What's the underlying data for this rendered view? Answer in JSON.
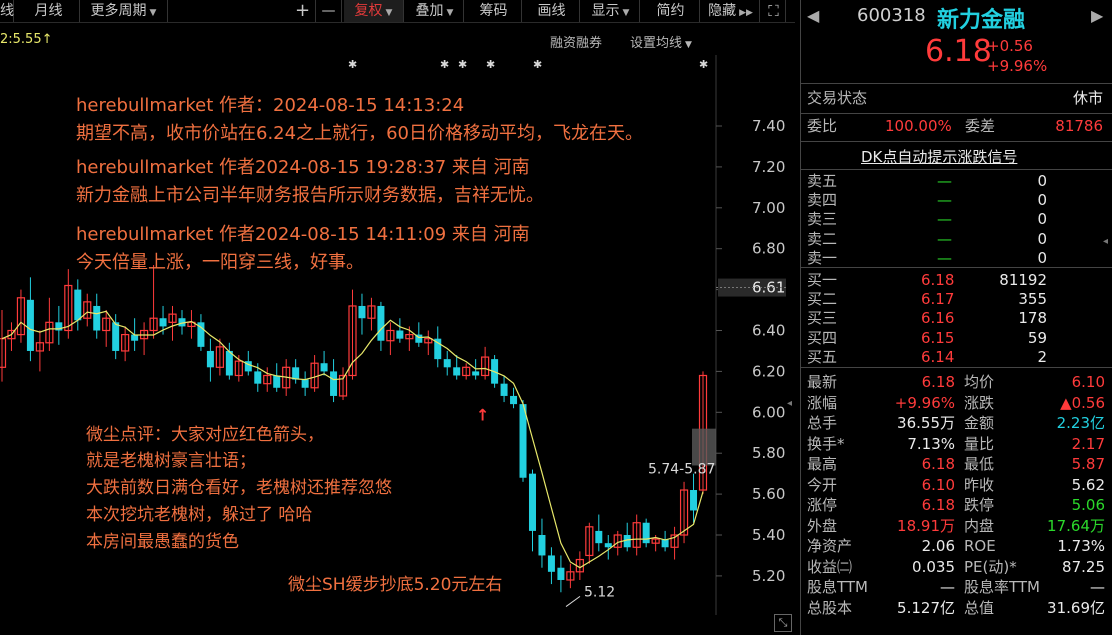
{
  "toolbar": {
    "left_fragment": "线",
    "items": [
      "月线",
      "更多周期",
      "+",
      "—",
      "复权",
      "叠加",
      "筹码",
      "画线",
      "显示",
      "简约",
      "隐藏"
    ],
    "expand_glyph": "⛶"
  },
  "subbar": {
    "ma_label": "2:5.55",
    "ma_arrow": "↑",
    "margin_label": "融资融券",
    "ma_settings_label": "设置均线"
  },
  "chart": {
    "price_axis": [
      "7.40",
      "7.20",
      "7.00",
      "6.80",
      "6.60",
      "6.40",
      "6.20",
      "6.00",
      "5.80",
      "5.60",
      "5.40",
      "5.20"
    ],
    "current_price_tag": "6.61",
    "range_label": "5.74-5.87",
    "low_label": "5.12",
    "notes": [
      {
        "header": "herebullmarket 作者：2024-08-15 14:13:24",
        "body": "期望不高，收市价站在6.24之上就行，60日价格移动平均，飞龙在天。"
      },
      {
        "header": "herebullmarket 作者2024-08-15 19:28:37 来自 河南",
        "body": "新力金融上市公司半年财务报告所示财务数据，吉祥无忧。"
      },
      {
        "header": "herebullmarket 作者2024-08-15 14:11:09 来自 河南",
        "body": "今天倍量上涨，一阳穿三线，好事。"
      }
    ],
    "comment_lines": [
      "微尘点评：大家对应红色箭头，",
      "就是老槐树豪言壮语；",
      "大跌前数日满仓看好，老槐树还推荐忽悠",
      "本次挖坑老槐树，躲过了 哈哈",
      "本房间最愚蠢的货色"
    ],
    "bottom_comment": "微尘SH缓步抄底5.20元左右",
    "candles": [
      [
        6.22,
        6.5,
        6.15,
        6.36
      ],
      [
        6.36,
        6.44,
        6.3,
        6.4
      ],
      [
        6.38,
        6.6,
        6.34,
        6.56
      ],
      [
        6.55,
        6.66,
        6.25,
        6.3
      ],
      [
        6.3,
        6.4,
        6.2,
        6.34
      ],
      [
        6.34,
        6.56,
        6.3,
        6.44
      ],
      [
        6.44,
        6.52,
        6.33,
        6.4
      ],
      [
        6.4,
        6.7,
        6.36,
        6.62
      ],
      [
        6.6,
        6.65,
        6.4,
        6.45
      ],
      [
        6.46,
        6.58,
        6.42,
        6.54
      ],
      [
        6.52,
        6.58,
        6.36,
        6.4
      ],
      [
        6.4,
        6.5,
        6.32,
        6.46
      ],
      [
        6.44,
        6.48,
        6.26,
        6.3
      ],
      [
        6.3,
        6.42,
        6.25,
        6.38
      ],
      [
        6.38,
        6.46,
        6.3,
        6.35
      ],
      [
        6.36,
        6.44,
        6.28,
        6.4
      ],
      [
        6.4,
        6.72,
        6.36,
        6.46
      ],
      [
        6.46,
        6.52,
        6.38,
        6.42
      ],
      [
        6.44,
        6.52,
        6.35,
        6.48
      ],
      [
        6.46,
        6.5,
        6.38,
        6.42
      ],
      [
        6.42,
        6.5,
        6.36,
        6.44
      ],
      [
        6.44,
        6.48,
        6.3,
        6.32
      ],
      [
        6.3,
        6.36,
        6.15,
        6.22
      ],
      [
        6.22,
        6.36,
        6.18,
        6.32
      ],
      [
        6.3,
        6.34,
        6.16,
        6.18
      ],
      [
        6.18,
        6.28,
        6.15,
        6.25
      ],
      [
        6.25,
        6.3,
        6.18,
        6.2
      ],
      [
        6.2,
        6.24,
        6.1,
        6.14
      ],
      [
        6.14,
        6.22,
        6.1,
        6.18
      ],
      [
        6.18,
        6.24,
        6.1,
        6.12
      ],
      [
        6.12,
        6.26,
        6.08,
        6.22
      ],
      [
        6.22,
        6.26,
        6.14,
        6.16
      ],
      [
        6.16,
        6.2,
        6.08,
        6.12
      ],
      [
        6.12,
        6.28,
        6.1,
        6.24
      ],
      [
        6.24,
        6.3,
        6.18,
        6.2
      ],
      [
        6.2,
        6.26,
        6.05,
        6.08
      ],
      [
        6.08,
        6.22,
        6.06,
        6.18
      ],
      [
        6.18,
        6.6,
        6.16,
        6.52
      ],
      [
        6.52,
        6.58,
        6.38,
        6.46
      ],
      [
        6.46,
        6.56,
        6.4,
        6.52
      ],
      [
        6.52,
        6.54,
        6.3,
        6.35
      ],
      [
        6.35,
        6.44,
        6.28,
        6.4
      ],
      [
        6.4,
        6.46,
        6.34,
        6.36
      ],
      [
        6.36,
        6.42,
        6.3,
        6.38
      ],
      [
        6.38,
        6.44,
        6.32,
        6.34
      ],
      [
        6.34,
        6.4,
        6.28,
        6.36
      ],
      [
        6.36,
        6.42,
        6.22,
        6.26
      ],
      [
        6.26,
        6.3,
        6.18,
        6.22
      ],
      [
        6.22,
        6.28,
        6.16,
        6.18
      ],
      [
        6.18,
        6.24,
        6.16,
        6.22
      ],
      [
        6.2,
        6.26,
        6.16,
        6.18
      ],
      [
        6.18,
        6.32,
        6.16,
        6.27
      ],
      [
        6.26,
        6.28,
        6.12,
        6.14
      ],
      [
        6.14,
        6.18,
        6.05,
        6.08
      ],
      [
        6.08,
        6.12,
        6.02,
        6.04
      ],
      [
        6.04,
        6.06,
        5.66,
        5.68
      ],
      [
        5.7,
        5.72,
        5.32,
        5.42
      ],
      [
        5.4,
        5.48,
        5.24,
        5.3
      ],
      [
        5.3,
        5.34,
        5.16,
        5.22
      ],
      [
        5.24,
        5.3,
        5.12,
        5.18
      ],
      [
        5.18,
        5.26,
        5.14,
        5.22
      ],
      [
        5.22,
        5.32,
        5.18,
        5.28
      ],
      [
        5.3,
        5.46,
        5.26,
        5.44
      ],
      [
        5.42,
        5.5,
        5.32,
        5.36
      ],
      [
        5.36,
        5.4,
        5.28,
        5.34
      ],
      [
        5.34,
        5.42,
        5.3,
        5.4
      ],
      [
        5.4,
        5.46,
        5.32,
        5.34
      ],
      [
        5.34,
        5.5,
        5.3,
        5.46
      ],
      [
        5.46,
        5.48,
        5.34,
        5.36
      ],
      [
        5.36,
        5.4,
        5.32,
        5.38
      ],
      [
        5.38,
        5.42,
        5.32,
        5.34
      ],
      [
        5.34,
        5.44,
        5.28,
        5.4
      ],
      [
        5.4,
        5.66,
        5.36,
        5.62
      ],
      [
        5.62,
        5.7,
        5.46,
        5.52
      ],
      [
        5.62,
        6.2,
        5.6,
        6.18
      ]
    ]
  },
  "quote": {
    "code": "600318",
    "name": "新力金融",
    "price": "6.18",
    "change": "+0.56",
    "change_pct": "+9.96%",
    "trade_status_label": "交易状态",
    "trade_status": "休市",
    "weibi_label": "委比",
    "weibi": "100.00%",
    "weicha_label": "委差",
    "weicha": "81786",
    "signal_title": "DK点自动提示涨跌信号",
    "asks": [
      {
        "label": "卖五",
        "price": "—",
        "vol": "0"
      },
      {
        "label": "卖四",
        "price": "—",
        "vol": "0"
      },
      {
        "label": "卖三",
        "price": "—",
        "vol": "0"
      },
      {
        "label": "卖二",
        "price": "—",
        "vol": "0"
      },
      {
        "label": "卖一",
        "price": "—",
        "vol": "0"
      }
    ],
    "bids": [
      {
        "label": "买一",
        "price": "6.18",
        "vol": "81192"
      },
      {
        "label": "买二",
        "price": "6.17",
        "vol": "355"
      },
      {
        "label": "买三",
        "price": "6.16",
        "vol": "178"
      },
      {
        "label": "买四",
        "price": "6.15",
        "vol": "59"
      },
      {
        "label": "买五",
        "price": "6.14",
        "vol": "2"
      }
    ],
    "stats": [
      {
        "l1": "最新",
        "v1": "6.18",
        "c1": "red",
        "l2": "均价",
        "v2": "6.10",
        "c2": "red"
      },
      {
        "l1": "涨幅",
        "v1": "+9.96%",
        "c1": "red",
        "l2": "涨跌",
        "v2": "▲0.56",
        "c2": "red"
      },
      {
        "l1": "总手",
        "v1": "36.55万",
        "c1": "white",
        "l2": "金额",
        "v2": "2.23亿",
        "c2": "cyan"
      },
      {
        "l1": "换手*",
        "v1": "7.13%",
        "c1": "white",
        "l2": "量比",
        "v2": "2.17",
        "c2": "red"
      },
      {
        "l1": "最高",
        "v1": "6.18",
        "c1": "red",
        "l2": "最低",
        "v2": "5.87",
        "c2": "red"
      },
      {
        "l1": "今开",
        "v1": "6.10",
        "c1": "red",
        "l2": "昨收",
        "v2": "5.62",
        "c2": "white"
      },
      {
        "l1": "涨停",
        "v1": "6.18",
        "c1": "red",
        "l2": "跌停",
        "v2": "5.06",
        "c2": "green"
      },
      {
        "l1": "外盘",
        "v1": "18.91万",
        "c1": "red",
        "l2": "内盘",
        "v2": "17.64万",
        "c2": "green"
      },
      {
        "l1": "净资产",
        "v1": "2.06",
        "c1": "white",
        "l2": "ROE",
        "v2": "1.73%",
        "c2": "white"
      },
      {
        "l1": "收益㈡",
        "v1": "0.035",
        "c1": "white",
        "l2": "PE(动)*",
        "v2": "87.25",
        "c2": "white"
      },
      {
        "l1": "股息TTM",
        "v1": "—",
        "c1": "white",
        "l2": "股息率TTM",
        "v2": "—",
        "c2": "white"
      },
      {
        "l1": "总股本",
        "v1": "5.127亿",
        "c1": "white",
        "l2": "总值",
        "v2": "31.69亿",
        "c2": "white"
      }
    ]
  },
  "colors": {
    "up": "#ff3b3b",
    "down": "#22d0e0",
    "ma": "#e8e86a",
    "note": "#f07040"
  }
}
